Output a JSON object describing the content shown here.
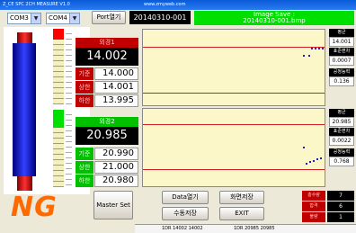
{
  "window": {
    "title": "Z_CE SPC 2CH MEASURE V1.0",
    "subtitle": "www.zmyweb.com"
  },
  "toolbar": {
    "com_port_1": "COM3",
    "com_port_2": "COM4",
    "port_open_label": "Port열기",
    "file_id": "20140310-001",
    "image_save_title": "Image Save :",
    "image_save_file": "20140310-001.bmp"
  },
  "channel1": {
    "title": "외경1",
    "value": "14.002",
    "rows": [
      {
        "label": "기준",
        "value": "14.000"
      },
      {
        "label": "상한",
        "value": "14.001"
      },
      {
        "label": "하한",
        "value": "13.995"
      }
    ],
    "stats": [
      {
        "label": "평균",
        "value": "14.001"
      },
      {
        "label": "표준편차",
        "value": "0.0007"
      },
      {
        "label": "공정능력",
        "value": "0.136"
      }
    ]
  },
  "channel2": {
    "title": "외경2",
    "value": "20.985",
    "rows": [
      {
        "label": "기준",
        "value": "20.990"
      },
      {
        "label": "상한",
        "value": "21.000"
      },
      {
        "label": "하한",
        "value": "20.980"
      }
    ],
    "stats": [
      {
        "label": "평균",
        "value": "20.985"
      },
      {
        "label": "표준편차",
        "value": "0.0022"
      },
      {
        "label": "공정능력",
        "value": "0.768"
      }
    ]
  },
  "result": {
    "text": "NG",
    "color": "#ff6a00"
  },
  "buttons": {
    "master_set": "Master Set",
    "data_open": "Data열기",
    "screen_save": "화면저장",
    "manual_save": "수동저장",
    "exit": "EXIT"
  },
  "counts": [
    {
      "label": "총수량",
      "value": "7"
    },
    {
      "label": "합격",
      "value": "6"
    },
    {
      "label": "불량",
      "value": "1"
    }
  ],
  "statusbar": {
    "left": "1DR 14002 14002",
    "right": "1DR 20985 20985"
  }
}
